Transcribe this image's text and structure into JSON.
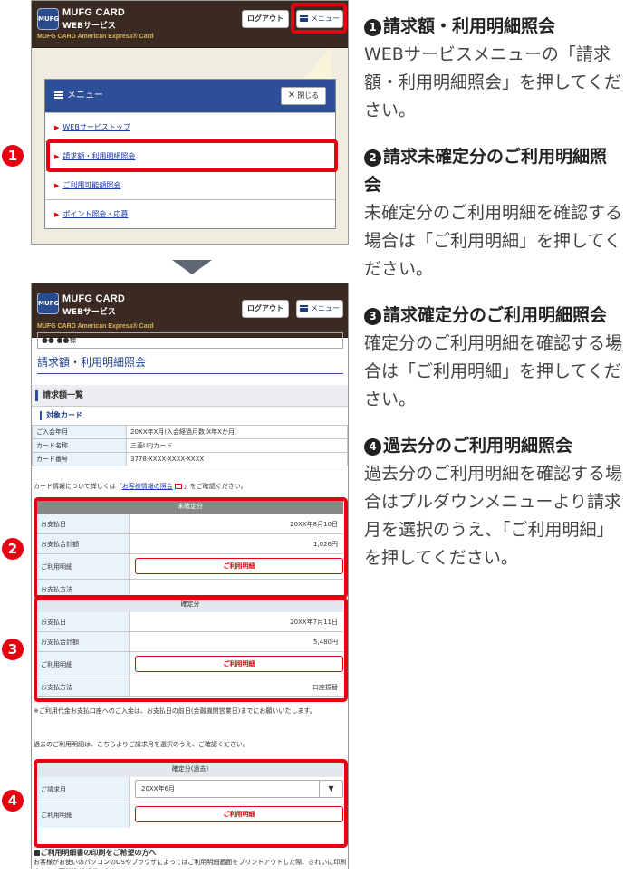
{
  "app": {
    "logo_icon": "mufg-card-logo-icon",
    "brand_line1": "MUFG CARD",
    "brand_line2": "WEBサービス",
    "brand_line3": "MUFG CARD American Express® Card",
    "logout_label": "ログアウト",
    "menu_label": "メニュー"
  },
  "menu": {
    "title": "メニュー",
    "close_label": "閉じる",
    "items": [
      {
        "label": "WEBサービストップ"
      },
      {
        "label": "請求額・利用明細照会"
      },
      {
        "label": "ご利用可能額照会"
      },
      {
        "label": "ポイント照会・応募"
      }
    ]
  },
  "badges": {
    "b1": "1",
    "b2": "2",
    "b3": "3",
    "b4": "4"
  },
  "statement": {
    "user": "●● ●●様",
    "page_title": "請求額・利用明細照会",
    "section_title": "請求額一覧",
    "target_card": "対象カード",
    "card_rows": [
      {
        "label": "ご入会年月",
        "value": "20XX年X月(入会経過月数:X年Xか月)"
      },
      {
        "label": "カード名称",
        "value": "三菱UFJカード"
      },
      {
        "label": "カード番号",
        "value": "3778-XXXX-XXXX-XXXX"
      }
    ],
    "card_note_pre": "カード情報について詳しくは「",
    "card_note_link": "お客様情報の照会",
    "card_note_post": "」をご確認ください。",
    "unconfirmed": {
      "title": "未確定分",
      "pay_date_label": "お支払日",
      "pay_date": "20XX年8月10日",
      "total_label": "お支払合計額",
      "total": "1,026円",
      "detail_label": "ご利用明細",
      "detail_button": "ご利用明細",
      "method_label": "お支払方法",
      "method": ""
    },
    "confirmed": {
      "title": "確定分",
      "pay_date_label": "お支払日",
      "pay_date": "20XX年7月11日",
      "total_label": "お支払合計額",
      "total": "5,480円",
      "detail_label": "ご利用明細",
      "detail_button": "ご利用明細",
      "method_label": "お支払方法",
      "method": "口座振替"
    },
    "note_transfer": "※ご利用代金お支払口座へのご入金は、お支払日の前日(金融機関営業日)までにお願いいたします。",
    "note_past": "過去のご利用明細は、こちらよりご請求月を選択のうえ、ご確認ください。",
    "past": {
      "title": "確定分(過去)",
      "month_label": "ご請求月",
      "month_value": "20XX年6月",
      "detail_label": "ご利用明細",
      "detail_button": "ご利用明細"
    },
    "print_title": "■ご利用明細書の印刷をご希望の方へ",
    "print_text": "お客様がお使いのパソコンのOSやブラウザによってはご利用明細画面をプリントアウトした際、きれいに印刷されない可能性がございます。"
  },
  "instructions": [
    {
      "num": "1",
      "title": "請求額・利用明細照会",
      "body": "WEBサービスメニューの「請求額・利用明細照会」を押してください。"
    },
    {
      "num": "2",
      "title": "請求未確定分のご利用明細照会",
      "body": "未確定分のご利用明細を確認する場合は「ご利用明細」を押してください。"
    },
    {
      "num": "3",
      "title": "請求確定分のご利用明細照会",
      "body": "確定分のご利用明細を確認する場合は「ご利用明細」を押してください。"
    },
    {
      "num": "4",
      "title": "過去分のご利用明細照会",
      "body": "過去分のご利用明細を確認する場合はプルダウンメニューより請求月を選択のうえ、「ご利用明細」を押してください。"
    }
  ],
  "colors": {
    "accent_red": "#e60012",
    "header_brown": "#3a2a22",
    "menu_blue": "#2d4f98"
  }
}
